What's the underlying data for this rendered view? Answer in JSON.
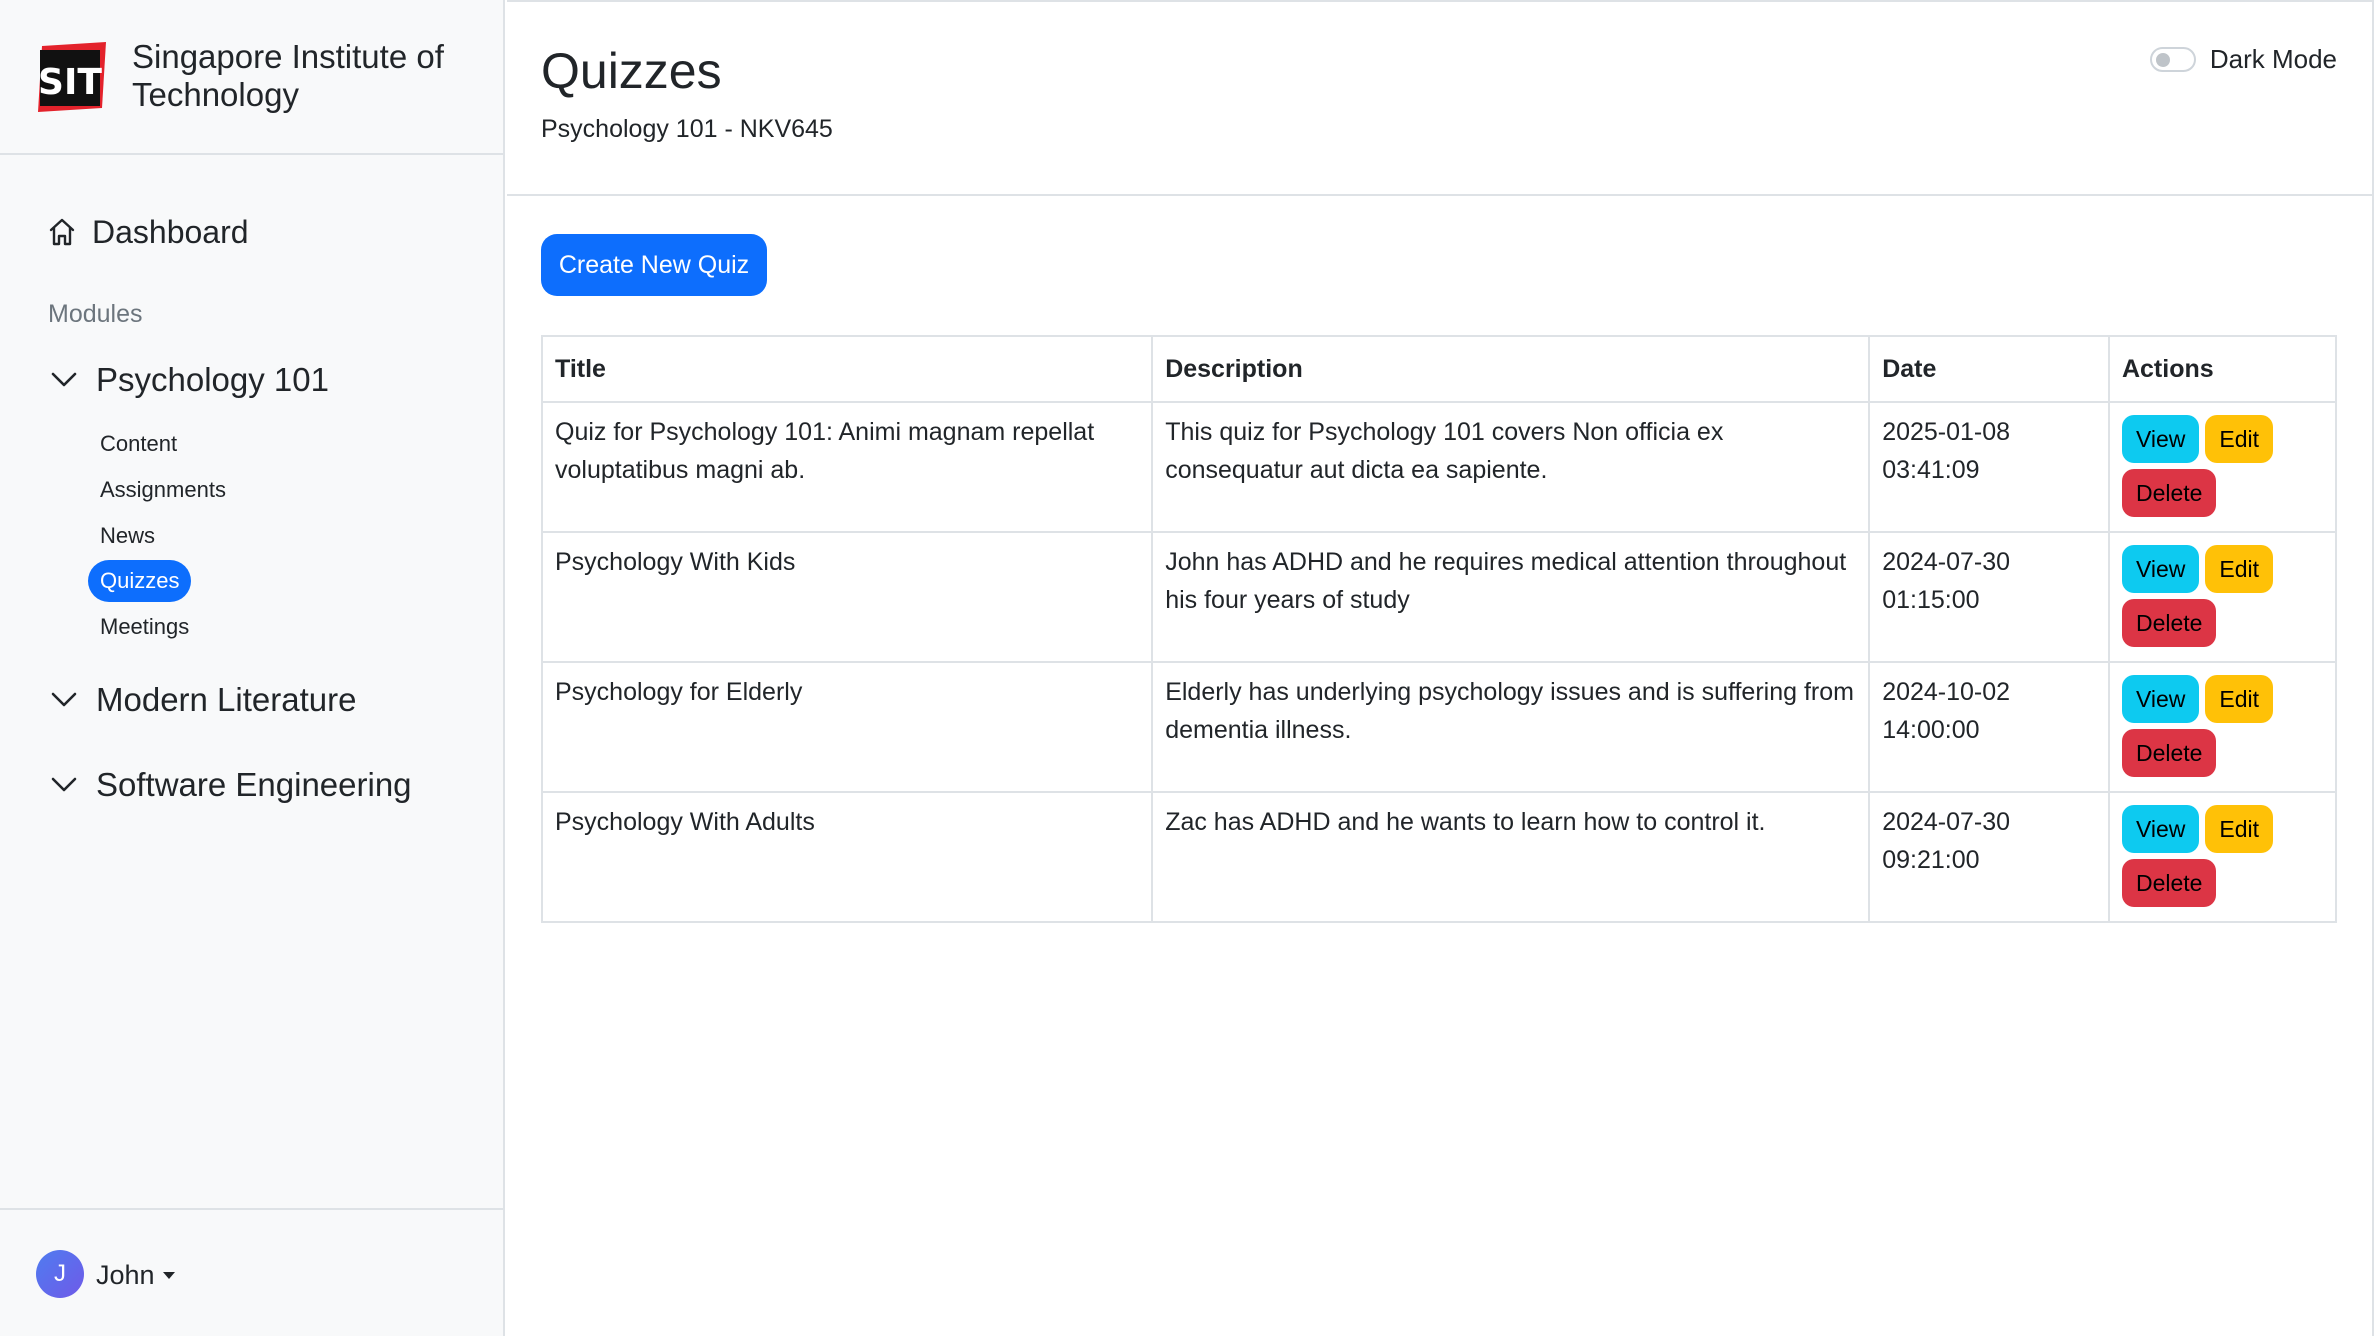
{
  "brand": {
    "logo_text": "SIT",
    "name": "Singapore Institute of Technology"
  },
  "sidebar": {
    "dashboard_label": "Dashboard",
    "modules_heading": "Modules",
    "modules": [
      {
        "label": "Psychology 101",
        "expanded": true,
        "items": [
          {
            "label": "Content",
            "active": false
          },
          {
            "label": "Assignments",
            "active": false
          },
          {
            "label": "News",
            "active": false
          },
          {
            "label": "Quizzes",
            "active": true
          },
          {
            "label": "Meetings",
            "active": false
          }
        ]
      },
      {
        "label": "Modern Literature",
        "expanded": false
      },
      {
        "label": "Software Engineering",
        "expanded": false
      }
    ]
  },
  "user": {
    "initial": "J",
    "name": "John"
  },
  "header": {
    "title": "Quizzes",
    "subtitle": "Psychology 101 - NKV645",
    "dark_mode_label": "Dark Mode",
    "dark_mode_on": false
  },
  "toolbar": {
    "create_label": "Create New Quiz"
  },
  "table": {
    "columns": [
      "Title",
      "Description",
      "Date",
      "Actions"
    ],
    "action_labels": {
      "view": "View",
      "edit": "Edit",
      "delete": "Delete"
    },
    "rows": [
      {
        "title": "Quiz for Psychology 101: Animi magnam repellat voluptatibus magni ab.",
        "description": "This quiz for Psychology 101 covers Non officia ex consequatur aut dicta ea sapiente.",
        "date": "2025-01-08",
        "time": "03:41:09"
      },
      {
        "title": "Psychology With Kids",
        "description": "John has ADHD and he requires medical attention throughout his four years of study",
        "date": "2024-07-30",
        "time": "01:15:00"
      },
      {
        "title": "Psychology for Elderly",
        "description": "Elderly has underlying psychology issues and is suffering from dementia illness.",
        "date": "2024-10-02",
        "time": "14:00:00"
      },
      {
        "title": "Psychology With Adults",
        "description": "Zac has ADHD and he wants to learn how to control it.",
        "date": "2024-07-30",
        "time": "09:21:00"
      }
    ]
  },
  "colors": {
    "primary": "#0d6efd",
    "view": "#0dcaf0",
    "edit": "#ffc107",
    "delete": "#dc3545",
    "logo_red": "#e3222b"
  }
}
